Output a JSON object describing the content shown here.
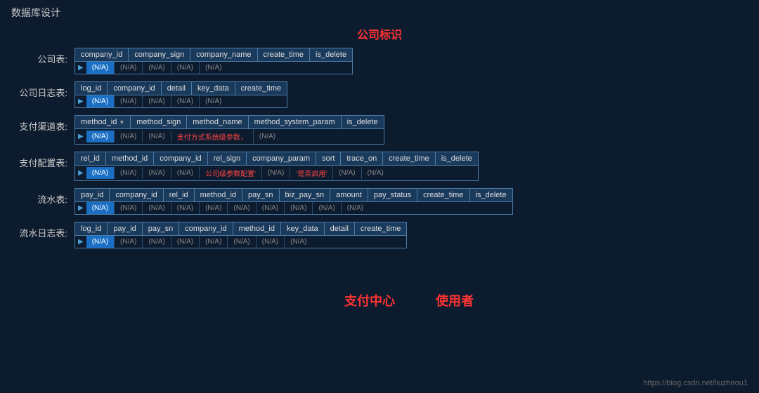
{
  "page": {
    "title": "数据库设计",
    "center_label": "公司标识",
    "footer_url": "https://blog.csdn.net/liuzhirou1"
  },
  "tables": [
    {
      "label": "公司表:",
      "columns": [
        "company_id",
        "company_sign",
        "company_name",
        "create_time",
        "is_delete"
      ],
      "values": [
        "(N/A)",
        "(N/A)",
        "(N/A)",
        "(N/A)",
        "(N/A)"
      ],
      "highlighted": [
        0
      ],
      "red_cols": []
    },
    {
      "label": "公司日志表:",
      "columns": [
        "log_id",
        "company_id",
        "detail",
        "key_data",
        "create_time"
      ],
      "values": [
        "(N/A)",
        "(N/A)",
        "(N/A)",
        "(N/A)",
        "(N/A)"
      ],
      "highlighted": [
        0
      ],
      "red_cols": []
    },
    {
      "label": "支付渠道表:",
      "columns": [
        "method_id",
        "method_sign",
        "method_name",
        "method_system_param",
        "is_delete"
      ],
      "values": [
        "(N/A)",
        "(N/A)",
        "(N/A)",
        "支付方式系统级参数，",
        "(N/A)"
      ],
      "highlighted": [
        0
      ],
      "red_cols": [
        3
      ],
      "pk_arrow": 0
    },
    {
      "label": "支付配置表:",
      "columns": [
        "rel_id",
        "method_id",
        "company_id",
        "rel_sign",
        "company_param",
        "sort",
        "trace_on",
        "create_time",
        "is_delete"
      ],
      "values": [
        "(N/A)",
        "(N/A)",
        "(N/A)",
        "(N/A)",
        "公司级参数配置'",
        "(N/A)",
        "'是否启用'",
        "(N/A)",
        "(N/A)"
      ],
      "highlighted": [
        0
      ],
      "red_cols": [
        4,
        6
      ]
    },
    {
      "label": "流水表:",
      "columns": [
        "pay_id",
        "company_id",
        "rel_id",
        "method_id",
        "pay_sn",
        "biz_pay_sn",
        "amount",
        "pay_status",
        "create_time",
        "is_delete"
      ],
      "values": [
        "(N/A)",
        "(N/A)",
        "(N/A)",
        "(N/A)",
        "(N/A)",
        "(N/A)",
        "(N/A)",
        "(N/A)",
        "(N/A)",
        "(N/A)"
      ],
      "highlighted": [
        0
      ],
      "red_cols": [],
      "has_overlay": true
    },
    {
      "label": "流水日志表:",
      "columns": [
        "log_id",
        "pay_id",
        "pay_sn",
        "company_id",
        "method_id",
        "key_data",
        "detail",
        "create_time"
      ],
      "values": [
        "(N/A)",
        "(N/A)",
        "(N/A)",
        "(N/A)",
        "(N/A)",
        "(N/A)",
        "(N/A)",
        "(N/A)"
      ],
      "highlighted": [
        0
      ],
      "red_cols": []
    }
  ],
  "overlays": {
    "pay_center": "支付中心",
    "user": "使用者"
  }
}
